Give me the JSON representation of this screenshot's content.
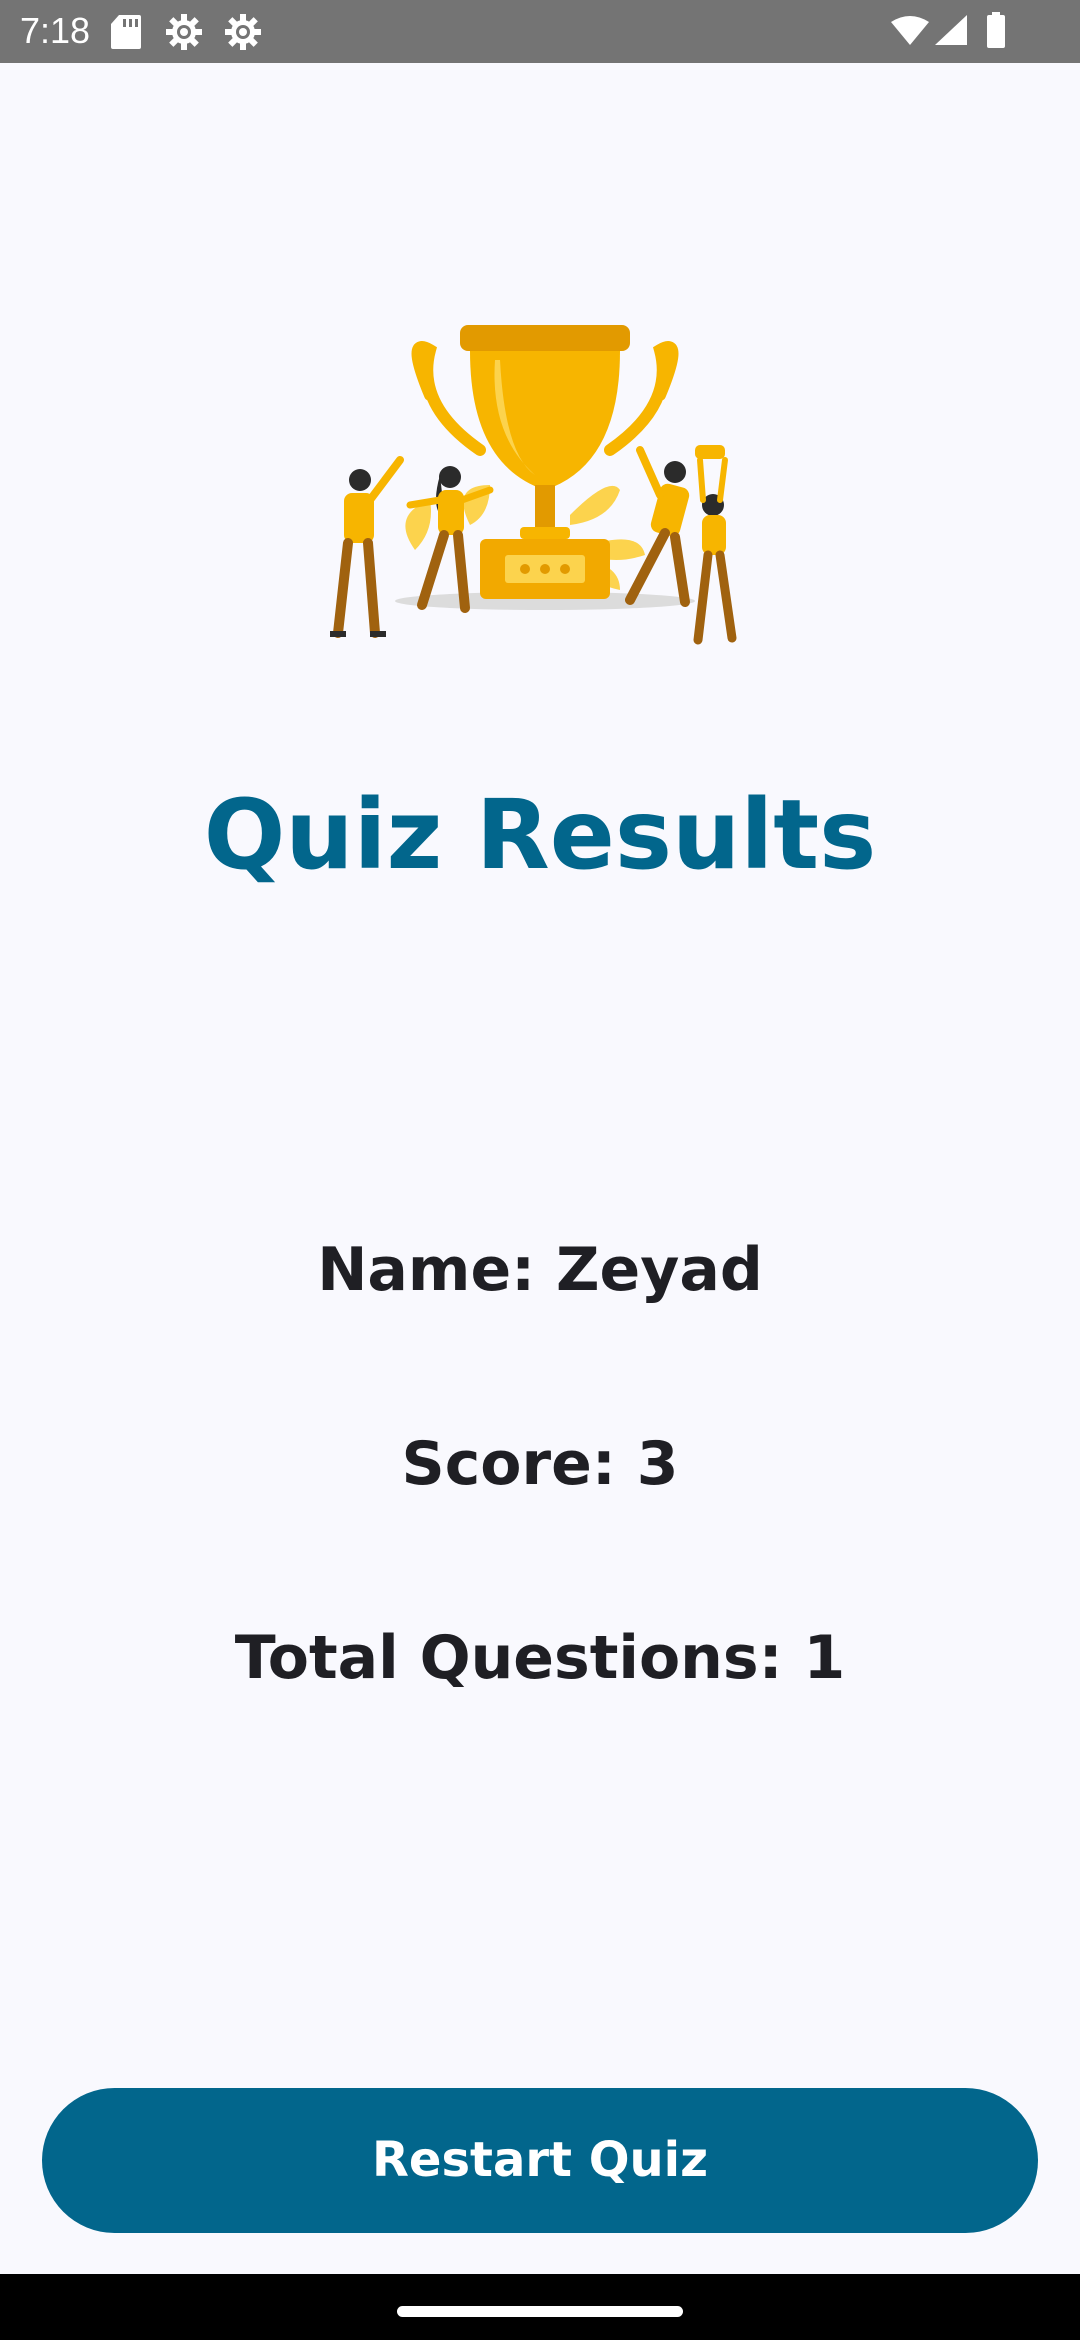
{
  "status_bar": {
    "time": "7:18",
    "left_icons": [
      "sd-card-icon",
      "settings-gear-icon",
      "settings-gear-icon"
    ],
    "right_icons": [
      "wifi-icon",
      "cell-signal-icon",
      "battery-icon"
    ]
  },
  "illustration": {
    "name": "trophy-celebration-illustration",
    "colors": {
      "gold": "#f7b500",
      "gold_dark": "#e29a00",
      "brown": "#a0620f",
      "dark": "#2b2b2b"
    }
  },
  "title": "Quiz Results",
  "results": {
    "name_line": "Name: Zeyad",
    "score_line": "Score: 3",
    "total_line": "Total Questions: 1"
  },
  "actions": {
    "restart_label": "Restart Quiz"
  },
  "theme": {
    "accent": "#02668c",
    "background": "#f9f9fe",
    "text": "#1f1f24",
    "status_bar": "#747474"
  }
}
